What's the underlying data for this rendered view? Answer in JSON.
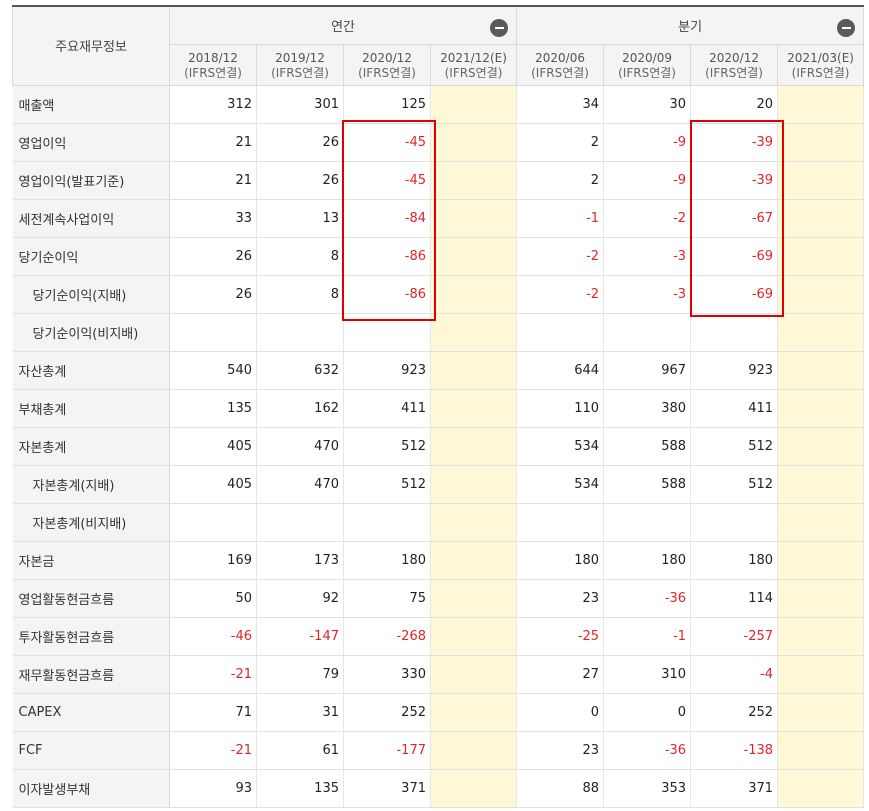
{
  "header": {
    "corner": "주요재무정보",
    "annual": {
      "label": "연간",
      "collapse_icon": "minus-circle-icon"
    },
    "quarterly": {
      "label": "분기",
      "collapse_icon": "minus-circle-icon"
    },
    "periods": [
      {
        "date": "2018/12",
        "basis": "(IFRS연결)"
      },
      {
        "date": "2019/12",
        "basis": "(IFRS연결)"
      },
      {
        "date": "2020/12",
        "basis": "(IFRS연결)"
      },
      {
        "date": "2021/12(E)",
        "basis": "(IFRS연결)"
      },
      {
        "date": "2020/06",
        "basis": "(IFRS연결)"
      },
      {
        "date": "2020/09",
        "basis": "(IFRS연결)"
      },
      {
        "date": "2020/12",
        "basis": "(IFRS연결)"
      },
      {
        "date": "2021/03(E)",
        "basis": "(IFRS연결)"
      }
    ]
  },
  "rows": [
    {
      "label": "매출액",
      "indent": false,
      "values": [
        "312",
        "301",
        "125",
        "",
        "34",
        "30",
        "20",
        ""
      ]
    },
    {
      "label": "영업이익",
      "indent": false,
      "values": [
        "21",
        "26",
        "-45",
        "",
        "2",
        "-9",
        "-39",
        ""
      ]
    },
    {
      "label": "영업이익(발표기준)",
      "indent": false,
      "values": [
        "21",
        "26",
        "-45",
        "",
        "2",
        "-9",
        "-39",
        ""
      ]
    },
    {
      "label": "세전계속사업이익",
      "indent": false,
      "values": [
        "33",
        "13",
        "-84",
        "",
        "-1",
        "-2",
        "-67",
        ""
      ]
    },
    {
      "label": "당기순이익",
      "indent": false,
      "values": [
        "26",
        "8",
        "-86",
        "",
        "-2",
        "-3",
        "-69",
        ""
      ]
    },
    {
      "label": "당기순이익(지배)",
      "indent": true,
      "values": [
        "26",
        "8",
        "-86",
        "",
        "-2",
        "-3",
        "-69",
        ""
      ]
    },
    {
      "label": "당기순이익(비지배)",
      "indent": true,
      "values": [
        "",
        "",
        "",
        "",
        "",
        "",
        "",
        ""
      ]
    },
    {
      "label": "자산총계",
      "indent": false,
      "values": [
        "540",
        "632",
        "923",
        "",
        "644",
        "967",
        "923",
        ""
      ]
    },
    {
      "label": "부채총계",
      "indent": false,
      "values": [
        "135",
        "162",
        "411",
        "",
        "110",
        "380",
        "411",
        ""
      ]
    },
    {
      "label": "자본총계",
      "indent": false,
      "values": [
        "405",
        "470",
        "512",
        "",
        "534",
        "588",
        "512",
        ""
      ]
    },
    {
      "label": "자본총계(지배)",
      "indent": true,
      "values": [
        "405",
        "470",
        "512",
        "",
        "534",
        "588",
        "512",
        ""
      ]
    },
    {
      "label": "자본총계(비지배)",
      "indent": true,
      "values": [
        "",
        "",
        "",
        "",
        "",
        "",
        "",
        ""
      ]
    },
    {
      "label": "자본금",
      "indent": false,
      "values": [
        "169",
        "173",
        "180",
        "",
        "180",
        "180",
        "180",
        ""
      ]
    },
    {
      "label": "영업활동현금흐름",
      "indent": false,
      "values": [
        "50",
        "92",
        "75",
        "",
        "23",
        "-36",
        "114",
        ""
      ]
    },
    {
      "label": "투자활동현금흐름",
      "indent": false,
      "values": [
        "-46",
        "-147",
        "-268",
        "",
        "-25",
        "-1",
        "-257",
        ""
      ]
    },
    {
      "label": "재무활동현금흐름",
      "indent": false,
      "values": [
        "-21",
        "79",
        "330",
        "",
        "27",
        "310",
        "-4",
        ""
      ]
    },
    {
      "label": "CAPEX",
      "indent": false,
      "values": [
        "71",
        "31",
        "252",
        "",
        "0",
        "0",
        "252",
        ""
      ]
    },
    {
      "label": "FCF",
      "indent": false,
      "values": [
        "-21",
        "61",
        "-177",
        "",
        "23",
        "-36",
        "-138",
        ""
      ]
    },
    {
      "label": "이자발생부채",
      "indent": false,
      "values": [
        "93",
        "135",
        "371",
        "",
        "88",
        "353",
        "371",
        ""
      ]
    }
  ],
  "colors": {
    "negative": "#e0252a",
    "estimate_bg": "#fff8d6",
    "header_bg": "#f4f4f4",
    "highlight_box": "#e00000"
  }
}
